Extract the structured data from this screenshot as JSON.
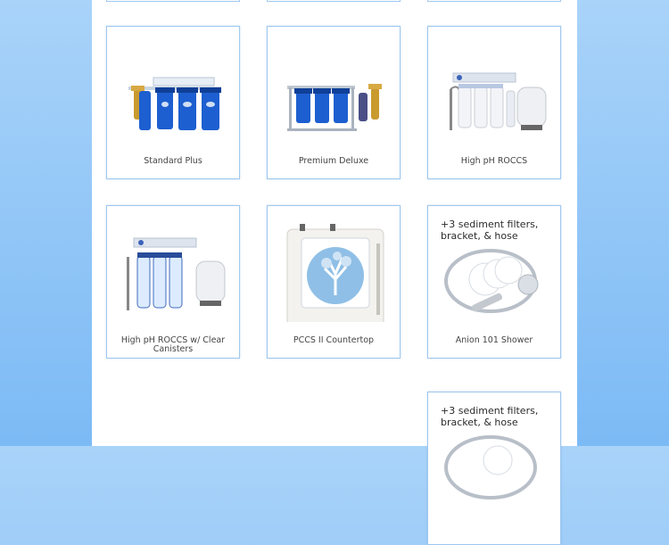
{
  "products": [
    {
      "name": "Standard Plus",
      "image": "triple-blue-filter-system"
    },
    {
      "name": "Premium Deluxe",
      "image": "stand-filter-system"
    },
    {
      "name": "High pH ROCCS",
      "image": "reverse-osmosis-system"
    },
    {
      "name": "High pH ROCCS w/ Clear Canisters",
      "image": "clear-canister-ro-system"
    },
    {
      "name": "PCCS II Countertop",
      "image": "countertop-ionizer"
    },
    {
      "name": "Anion 101 Shower",
      "image": "shower-filter-kit",
      "promo": "+3 sediment filters, bracket, & hose"
    },
    {
      "name": "",
      "image": "shower-filter-kit",
      "promo": "+3 sediment filters, bracket, & hose"
    }
  ],
  "colors": {
    "background": "#8cc4f7",
    "card_border": "#9fc8ee",
    "canister_blue": "#1d5fd0"
  }
}
